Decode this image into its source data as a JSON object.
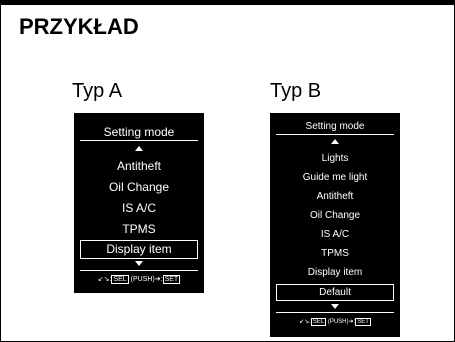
{
  "page": {
    "title": "PRZYKŁAD"
  },
  "typeA": {
    "label": "Typ A",
    "mode_title": "Setting mode",
    "items": [
      "Antitheft",
      "Oil Change",
      "IS A/C",
      "TPMS",
      "Display item"
    ],
    "selected_index": 4,
    "footer": {
      "sel": "SEL",
      "push": "(PUSH)",
      "set": "SET"
    }
  },
  "typeB": {
    "label": "Typ B",
    "mode_title": "Setting mode",
    "items": [
      "Lights",
      "Guide me light",
      "Antitheft",
      "Oil Change",
      "IS A/C",
      "TPMS",
      "Display item",
      "Default"
    ],
    "selected_index": 7,
    "footer": {
      "sel": "SEL",
      "push": "(PUSH)",
      "set": "SET"
    }
  },
  "icons": {
    "rocker": "rocker-switch-icon",
    "arrow_up": "arrow-up-icon",
    "arrow_down": "arrow-down-icon",
    "push": "push-arrow-icon"
  }
}
